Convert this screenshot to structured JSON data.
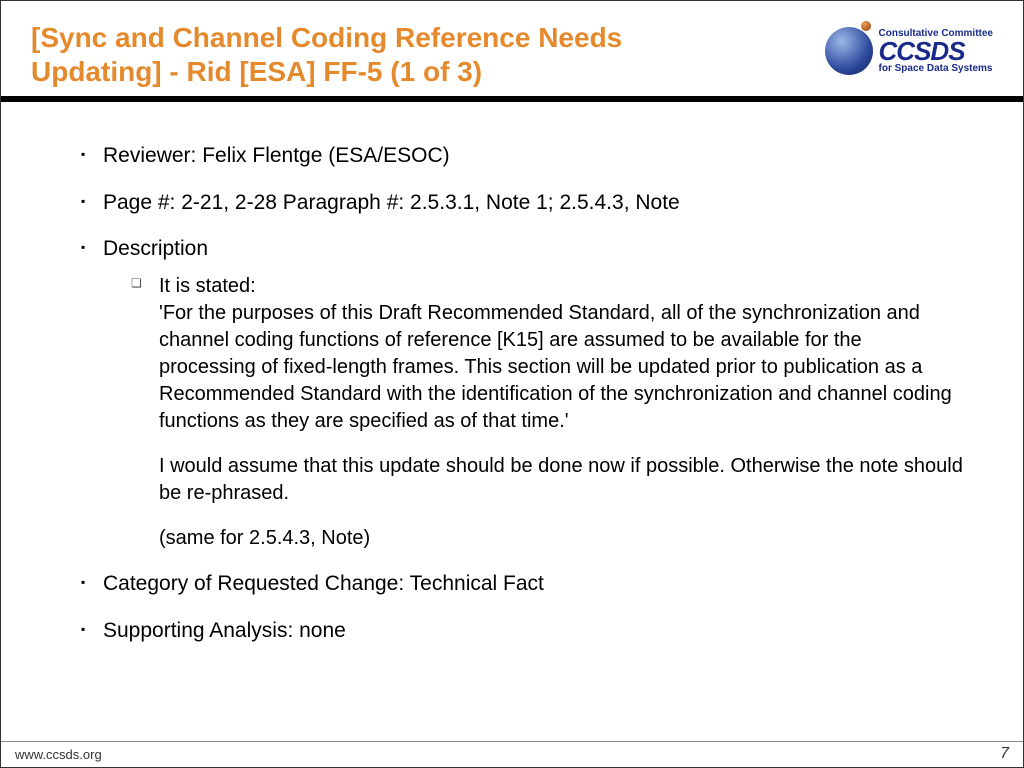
{
  "header": {
    "title": "[Sync and Channel Coding Reference Needs Updating] - Rid [ESA] FF-5 (1 of 3)",
    "logo": {
      "top": "Consultative Committee",
      "main": "CCSDS",
      "bottom": "for Space Data Systems"
    }
  },
  "bullets": {
    "reviewer": "Reviewer: Felix Flentge (ESA/ESOC)",
    "page": "Page #:   2-21, 2-28    Paragraph #:  2.5.3.1, Note 1; 2.5.4.3, Note",
    "description_label": "Description",
    "description_sub": {
      "line1": "It is stated:",
      "line2": "'For the purposes of this Draft Recommended Standard, all of the synchronization and channel coding functions of reference [K15] are assumed to be available for the processing of fixed-length frames. This section will be updated prior to publication as a Recommended Standard with the identification of the synchronization and channel coding functions as they are specified as of that time.'",
      "line3": "I would assume that this update should be done now if possible. Otherwise the note should be re-phrased.",
      "line4": "(same for 2.5.4.3, Note)"
    },
    "category": "Category of Requested Change: Technical Fact",
    "analysis": "Supporting Analysis: none"
  },
  "footer": {
    "url": "www.ccsds.org",
    "page": "7"
  }
}
